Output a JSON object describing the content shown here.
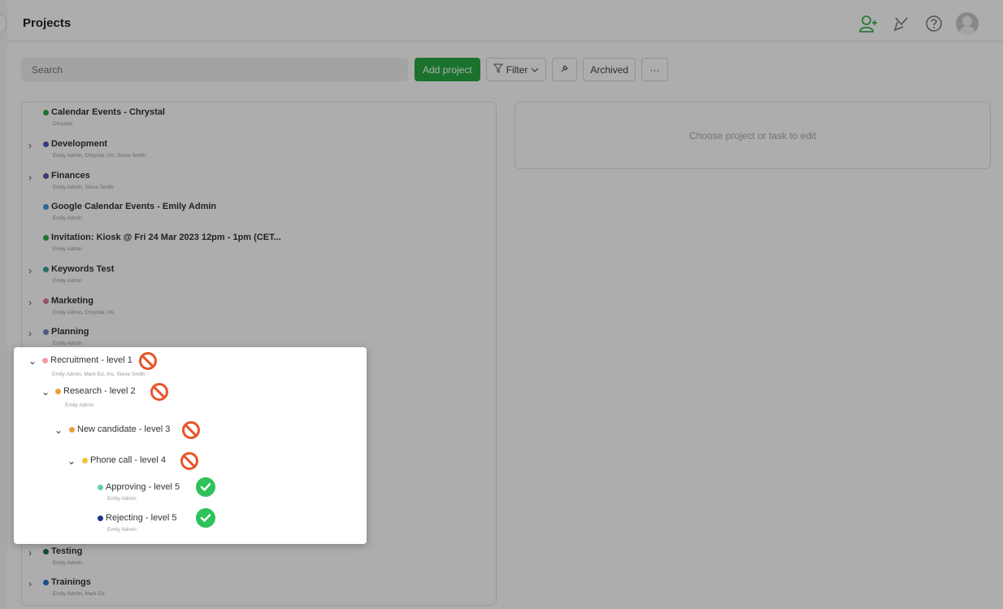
{
  "header": {
    "title": "Projects"
  },
  "icons": {
    "add_user": "add-user-icon",
    "plug": "plug-icon",
    "help": "help-icon",
    "avatar": "avatar"
  },
  "toolbar": {
    "search_placeholder": "Search",
    "add_project": "Add project",
    "filter": "Filter",
    "archived": "Archived",
    "more": "···"
  },
  "right_panel": {
    "placeholder": "Choose project or task to edit"
  },
  "colors": {
    "accent_green": "#27a843",
    "forbidden": "#e8552a",
    "allowed": "#2fc25b"
  },
  "projects": [
    {
      "name": "Calendar Events - Chrystal",
      "members": "Chrystal",
      "color": "#2aa846",
      "expandable": false
    },
    {
      "name": "Development",
      "members": "Emily Admin, Chrystal, Iris, Steve Smith",
      "color": "#4a57b8",
      "expandable": true
    },
    {
      "name": "Finances",
      "members": "Emily Admin, Steve Smith",
      "color": "#6b4bb0",
      "expandable": true
    },
    {
      "name": "Google Calendar Events - Emily Admin",
      "members": "Emily Admin",
      "color": "#3a9bd9",
      "expandable": false
    },
    {
      "name": "Invitation: Kiosk @ Fri 24 Mar 2023 12pm - 1pm (CET...",
      "members": "Emily Admin",
      "color": "#2aa846",
      "expandable": false
    },
    {
      "name": "Keywords Test",
      "members": "Emily Admin",
      "color": "#3fa29a",
      "expandable": true
    },
    {
      "name": "Marketing",
      "members": "Emily Admin, Chrystal, Iris",
      "color": "#e07a93",
      "expandable": true
    },
    {
      "name": "Planning",
      "members": "Emily Admin",
      "color": "#6e86b8",
      "expandable": true
    },
    {
      "name": "Testing",
      "members": "Emily Admin",
      "color": "#1d6c6a",
      "expandable": true
    },
    {
      "name": "Trainings",
      "members": "Emily Admin, Mark Ed",
      "color": "#2d6fd0",
      "expandable": true
    }
  ],
  "tree": [
    {
      "label": "Recruitment - level 1",
      "members": "Emily Admin, Mark Ed, Iris, Steve Smith",
      "color": "#f29aa6",
      "status": "forbidden"
    },
    {
      "label": "Research - level 2",
      "members": "Emily Admin",
      "color": "#e9a13b",
      "status": "forbidden"
    },
    {
      "label": "New candidate - level 3",
      "members": "",
      "color": "#e9a13b",
      "status": "forbidden"
    },
    {
      "label": "Phone call - level 4",
      "members": "",
      "color": "#f0c53a",
      "status": "forbidden"
    },
    {
      "label": "Approving - level 5",
      "members": "Emily Admin",
      "color": "#5fd2a4",
      "status": "allowed"
    },
    {
      "label": "Rejecting - level 5",
      "members": "Emily Admin",
      "color": "#1e3a8a",
      "status": "allowed"
    }
  ]
}
